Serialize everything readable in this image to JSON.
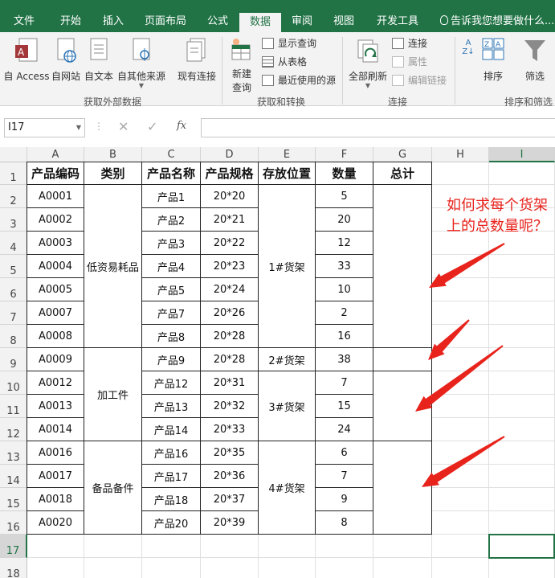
{
  "tabs": [
    {
      "label": "文件",
      "active": false
    },
    {
      "label": "开始",
      "active": false
    },
    {
      "label": "插入",
      "active": false
    },
    {
      "label": "页面布局",
      "active": false
    },
    {
      "label": "公式",
      "active": false
    },
    {
      "label": "数据",
      "active": true
    },
    {
      "label": "审阅",
      "active": false
    },
    {
      "label": "视图",
      "active": false
    },
    {
      "label": "开发工具",
      "active": false
    }
  ],
  "tellme": "告诉我您想要做什么...",
  "ribbon": {
    "from_access": "自 Access",
    "from_web": "自网站",
    "from_text": "自文本",
    "from_other": "自其他来源",
    "existing_conn": "现有连接",
    "new_query": "新建",
    "new_query2": "查询",
    "show_queries": "显示查询",
    "from_table": "从表格",
    "recent_sources": "最近使用的源",
    "refresh_all": "全部刷新",
    "connections": "连接",
    "properties": "属性",
    "edit_links": "编辑链接",
    "sort": "排序",
    "filter": "筛选",
    "group_external": "获取外部数据",
    "group_transform": "获取和转换",
    "group_conn": "连接",
    "group_sort": "排序和筛选"
  },
  "formula": {
    "namebox": "I17",
    "fx": "fx",
    "value": ""
  },
  "columns": [
    "A",
    "B",
    "C",
    "D",
    "E",
    "F",
    "G",
    "H",
    "I"
  ],
  "rows": [
    "1",
    "2",
    "3",
    "4",
    "5",
    "6",
    "7",
    "8",
    "9",
    "10",
    "11",
    "12",
    "13",
    "14",
    "15",
    "16",
    "17",
    "18"
  ],
  "table": {
    "headers": [
      "产品编码",
      "类别",
      "产品名称",
      "产品规格",
      "存放位置",
      "数量",
      "总计"
    ],
    "codes": [
      "A0001",
      "A0002",
      "A0003",
      "A0004",
      "A0005",
      "A0007",
      "A0008",
      "A0009",
      "A0012",
      "A0013",
      "A0014",
      "A0016",
      "A0017",
      "A0018",
      "A0020"
    ],
    "names": [
      "产品1",
      "产品2",
      "产品3",
      "产品4",
      "产品5",
      "产品7",
      "产品8",
      "产品9",
      "产品12",
      "产品13",
      "产品14",
      "产品16",
      "产品17",
      "产品18",
      "产品20"
    ],
    "specs": [
      "20*20",
      "20*21",
      "20*22",
      "20*23",
      "20*24",
      "20*26",
      "20*28",
      "20*28",
      "20*31",
      "20*32",
      "20*33",
      "20*35",
      "20*36",
      "20*37",
      "20*39"
    ],
    "qty": [
      "5",
      "20",
      "12",
      "33",
      "10",
      "2",
      "16",
      "38",
      "7",
      "15",
      "24",
      "6",
      "7",
      "9",
      "8"
    ],
    "categories": [
      "低资易耗品",
      "加工件",
      "备品备件"
    ],
    "locations": [
      "1#货架",
      "2#货架",
      "3#货架",
      "4#货架"
    ]
  },
  "annotation": "如何求每个货架上的总数量呢？",
  "colors": {
    "excel_green": "#217346",
    "annotation_red": "#e8231c"
  }
}
